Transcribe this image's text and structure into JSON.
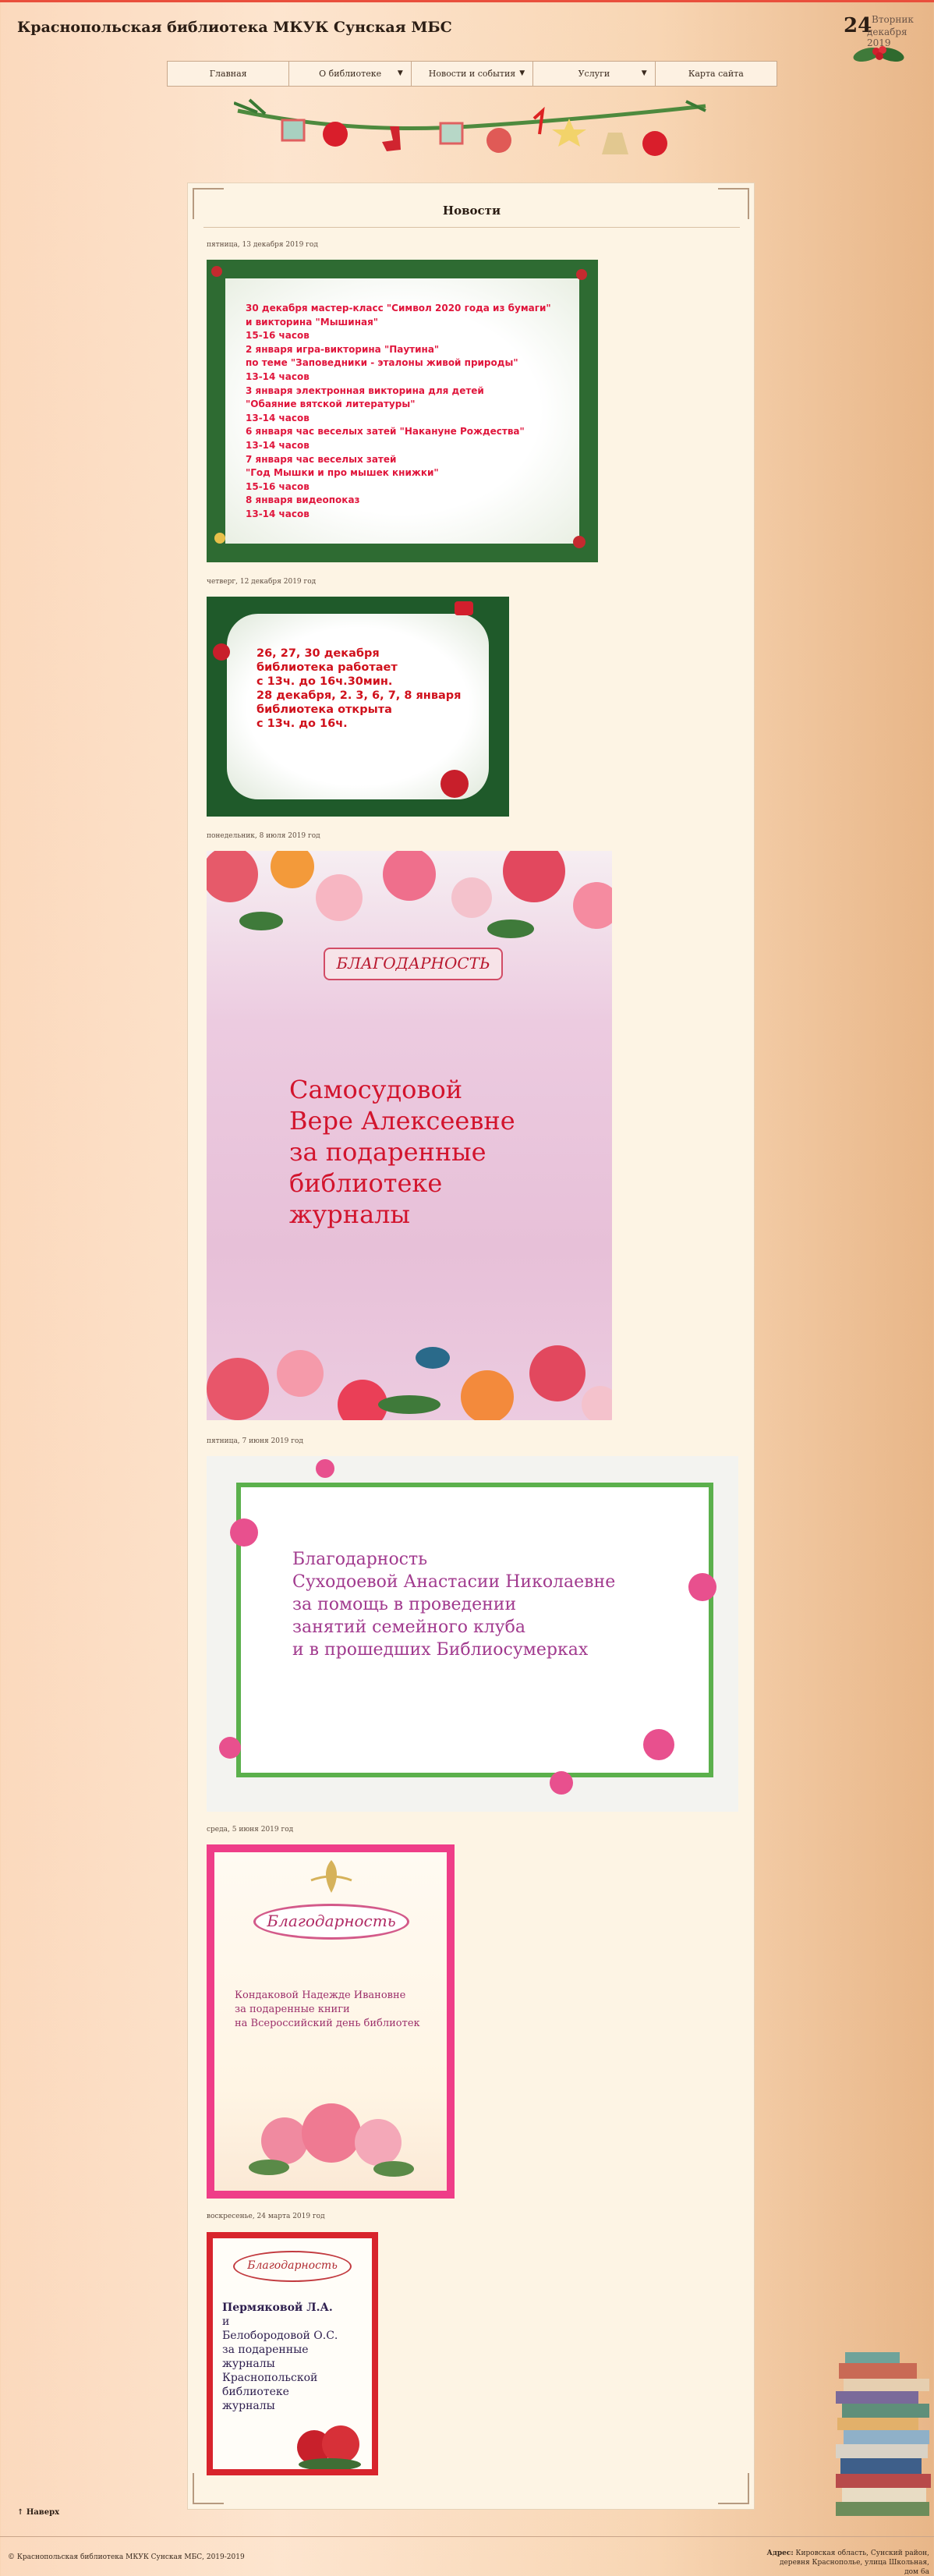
{
  "header": {
    "site_title": "Краснопольская библиотека МКУК Сунская МБС",
    "date_day": "24",
    "date_weekday": "Вторник",
    "date_month_year": "декабря 2019"
  },
  "nav": {
    "items": [
      {
        "label": "Главная"
      },
      {
        "label": "О библиотеке",
        "arrow": "▼"
      },
      {
        "label": "Новости и события",
        "arrow": "▼"
      },
      {
        "label": "Услуги",
        "arrow": "▼"
      },
      {
        "label": "Карта сайта"
      }
    ]
  },
  "main": {
    "title": "Новости",
    "posts": [
      {
        "date": "пятница, 13 декабря 2019 год",
        "lines": [
          "30 декабря мастер-класс \"Символ 2020 года  из бумаги\"",
          "и викторина \"Мышиная\"",
          "15-16 часов",
          "2 января игра-викторина \"Паутина\"",
          "по теме \"Заповедники - эталоны живой природы\"",
          "13-14 часов",
          "3 января электронная викторина для детей",
          "  \"Обаяние вятской литературы\"",
          "13-14 часов",
          "6 января час веселых затей \"Накануне Рождества\"",
          "13-14 часов",
          "7 января час веселых затей",
          "  \"Год Мышки и про мышек книжки\"",
          "15-16 часов",
          "8 января видеопоказ",
          "13-14 часов"
        ]
      },
      {
        "date": "четверг, 12 декабря 2019 год",
        "lines": [
          "26, 27, 30 декабря",
          "библиотека работает",
          "с 13ч. до 16ч.30мин.",
          "28 декабря, 2. 3, 6, 7, 8 января",
          "библиотека открыта",
          "с 13ч. до 16ч."
        ]
      },
      {
        "date": "понедельник, 8 июля 2019 год",
        "banner": "БЛАГОДАРНОСТЬ",
        "lines": [
          "Самосудовой",
          "Вере Алексеевне",
          "за подаренные",
          "библиотеке",
          "журналы"
        ]
      },
      {
        "date": "пятница, 7 июня 2019 год",
        "lines": [
          "Благодарность",
          "Суходоевой Анастасии Николаевне",
          "за помощь в проведении",
          "занятий семейного клуба",
          "и в прошедших Библиосумерках"
        ]
      },
      {
        "date": "среда, 5 июня 2019 год",
        "banner": "Благодарность",
        "lines": [
          "Кондаковой Надежде Ивановне",
          "за подаренные книги",
          "на Всероссийский день библиотек"
        ]
      },
      {
        "date": "воскресенье, 24 марта 2019 год",
        "banner": "Благодарность",
        "lines": [
          "Пермяковой Л.А.",
          "и",
          "Белобородовой О.С.",
          "за подаренные",
          "журналы",
          "Краснопольской",
          "библиотеке",
          "журналы"
        ]
      }
    ]
  },
  "footer": {
    "back_to_top": "↑ Наверх",
    "copyright": "© Краснопольская библиотека МКУК Сунская МБС, 2019-2019",
    "address_label": "Адрес:",
    "address_text": "Кировская область, Сунский район, деревня Краснополье, улица Школьная, дом 6а"
  },
  "colors": {
    "accent_red": "#e94f3c",
    "panel_bg": "#fdf4e4",
    "text_dark": "#2b1d14"
  }
}
